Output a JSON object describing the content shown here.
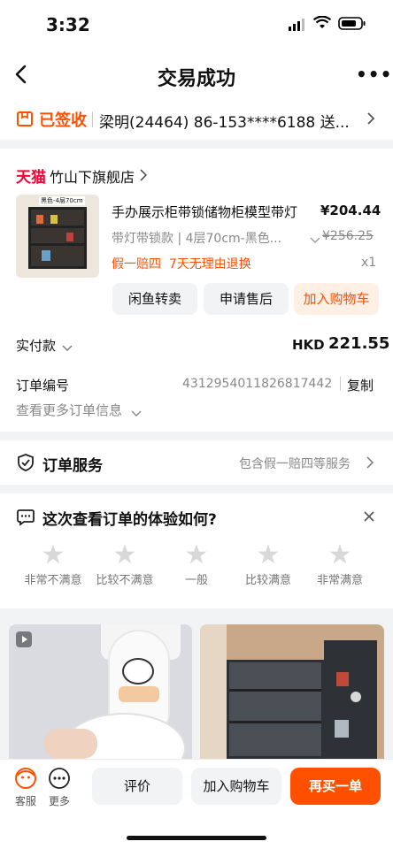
{
  "status": {
    "time": "3:32"
  },
  "nav": {
    "title": "交易成功",
    "more": "•••"
  },
  "sign": {
    "status": "已签收",
    "receiver": "梁明(24464)  86-153****6188  送..."
  },
  "store": {
    "platform": "天猫",
    "name": "竹山下旗舰店",
    "product": {
      "thumb_caption": "黑色-4层70cm",
      "title": "手办展示柜带锁储物柜模型带灯",
      "price": "¥204.44",
      "spec": "带灯带锁款 | 4层70cm-黑色...",
      "orig_price": "¥256.25",
      "service_tags": "假一赔四  7天无理由退换",
      "qty": "x1"
    },
    "actions": [
      "闲鱼转卖",
      "申请售后",
      "加入购物车"
    ],
    "paid_label": "实付款",
    "paid_currency": "HKD",
    "paid_amount": "221.55",
    "order_label": "订单编号",
    "order_no": "4312954011826817442",
    "copy": "复制",
    "more_info": "查看更多订单信息"
  },
  "service": {
    "label": "订单服务",
    "value": "包含假一赔四等服务"
  },
  "survey": {
    "question": "这次查看订单的体验如何?",
    "ratings": [
      "非常不满意",
      "比较不满意",
      "一般",
      "比较满意",
      "非常满意"
    ]
  },
  "bottom": {
    "service_label": "客服",
    "more_label": "更多",
    "review": "评价",
    "add_cart": "加入购物车",
    "rebuy": "再买一单"
  },
  "colors": {
    "accent": "#ff5000",
    "tmall": "#ff0036"
  }
}
